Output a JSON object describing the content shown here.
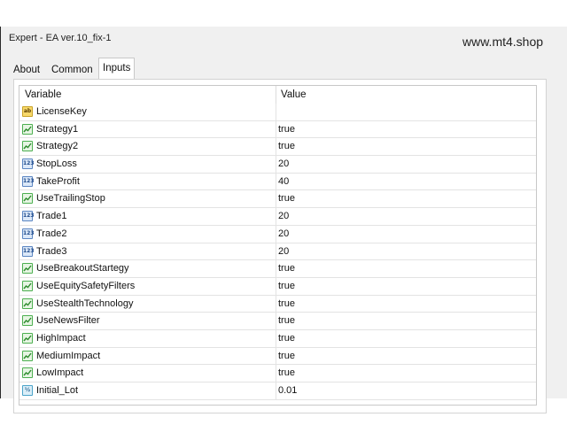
{
  "window": {
    "title": "Expert - EA  ver.10_fix-1",
    "watermark": "www.mt4.shop"
  },
  "tabs": [
    {
      "label": "About",
      "active": false
    },
    {
      "label": "Common",
      "active": false
    },
    {
      "label": "Inputs",
      "active": true
    }
  ],
  "table": {
    "headers": {
      "variable": "Variable",
      "value": "Value"
    },
    "rows": [
      {
        "name": "LicenseKey",
        "value": "",
        "icon": "string-icon"
      },
      {
        "name": "Strategy1",
        "value": "true",
        "icon": "bool-icon"
      },
      {
        "name": "Strategy2",
        "value": "true",
        "icon": "bool-icon"
      },
      {
        "name": "StopLoss",
        "value": "20",
        "icon": "int-icon"
      },
      {
        "name": "TakeProfit",
        "value": "40",
        "icon": "int-icon"
      },
      {
        "name": "UseTrailingStop",
        "value": "true",
        "icon": "bool-icon"
      },
      {
        "name": "Trade1",
        "value": "20",
        "icon": "int-icon"
      },
      {
        "name": "Trade2",
        "value": "20",
        "icon": "int-icon"
      },
      {
        "name": "Trade3",
        "value": "20",
        "icon": "int-icon"
      },
      {
        "name": "UseBreakoutStartegy",
        "value": "true",
        "icon": "bool-icon"
      },
      {
        "name": "UseEquitySafetyFilters",
        "value": "true",
        "icon": "bool-icon"
      },
      {
        "name": "UseStealthTechnology",
        "value": "true",
        "icon": "bool-icon"
      },
      {
        "name": "UseNewsFilter",
        "value": "true",
        "icon": "bool-icon"
      },
      {
        "name": "HighImpact",
        "value": "true",
        "icon": "bool-icon"
      },
      {
        "name": "MediumImpact",
        "value": "true",
        "icon": "bool-icon"
      },
      {
        "name": "LowImpact",
        "value": "true",
        "icon": "bool-icon"
      },
      {
        "name": "Initial_Lot",
        "value": "0.01",
        "icon": "double-icon"
      }
    ]
  },
  "icons": {
    "string-icon": {
      "glyph": "ab",
      "bg": "#f7d86a",
      "border": "#c9a227",
      "fg": "#5a3d00"
    },
    "bool-icon": {
      "glyph": "",
      "bg": "#e6f5e3",
      "border": "#4caf50",
      "fg": "#2e8b2e"
    },
    "int-icon": {
      "glyph": "123",
      "bg": "#dbe8f8",
      "border": "#5b86c2",
      "fg": "#1f4b8c"
    },
    "double-icon": {
      "glyph": "½",
      "bg": "#dbeef8",
      "border": "#4aa3c9",
      "fg": "#1f5d8c"
    }
  }
}
